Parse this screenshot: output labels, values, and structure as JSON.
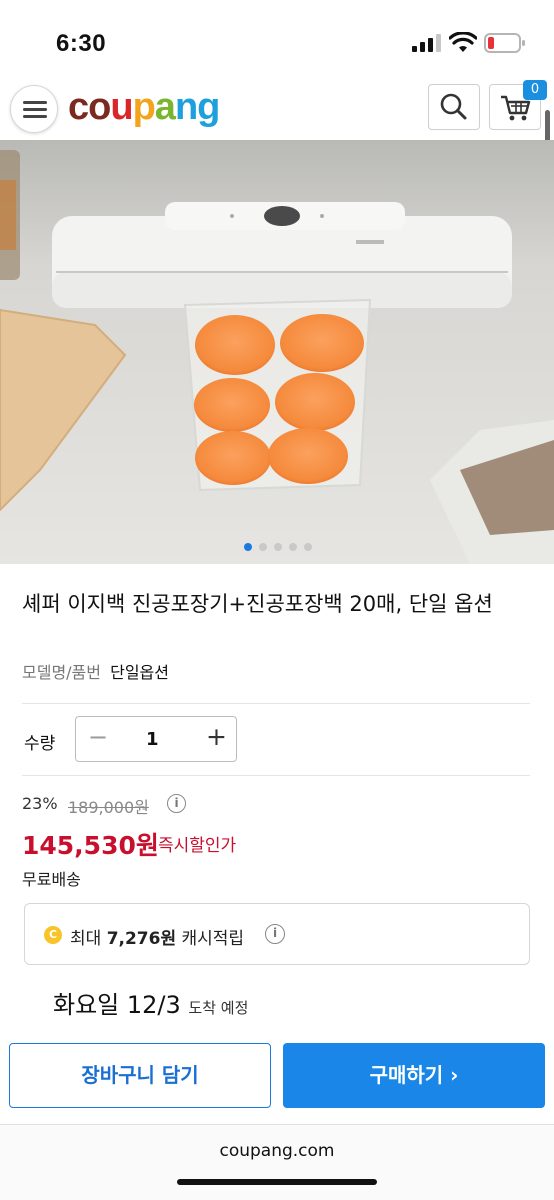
{
  "status_bar": {
    "time": "6:30"
  },
  "header": {
    "logo": {
      "c": "c",
      "o": "o",
      "u": "u",
      "p": "p",
      "a": "a",
      "n": "n",
      "g": "g"
    },
    "cart_count": "0"
  },
  "product": {
    "title": "셰퍼 이지백 진공포장기+진공포장백 20매, 단일 옵션",
    "model_label": "모델명/품번",
    "model_value": "단일옵션",
    "image_slide_count": 5,
    "image_slide_active": 1
  },
  "quantity": {
    "label": "수량",
    "minus": "−",
    "value": "1",
    "plus": "+"
  },
  "pricing": {
    "discount": "23%",
    "original_price": "189,000원",
    "info_icon": "i",
    "price": "145,530원",
    "price_tag": "즉시할인가",
    "shipping": "무료배송"
  },
  "cashback": {
    "coin": "C",
    "prefix": "최대",
    "amount": "7,276원",
    "suffix": "캐시적립",
    "info_icon": "i"
  },
  "delivery": {
    "date": "화요일 12/3",
    "note": "도착 예정"
  },
  "actions": {
    "add_to_cart": "장바구니 담기",
    "buy_now": "구매하기 ›"
  },
  "browser": {
    "url": "coupang.com"
  },
  "colors": {
    "brand_blue": "#1a86e8",
    "price_red": "#c8102e"
  }
}
